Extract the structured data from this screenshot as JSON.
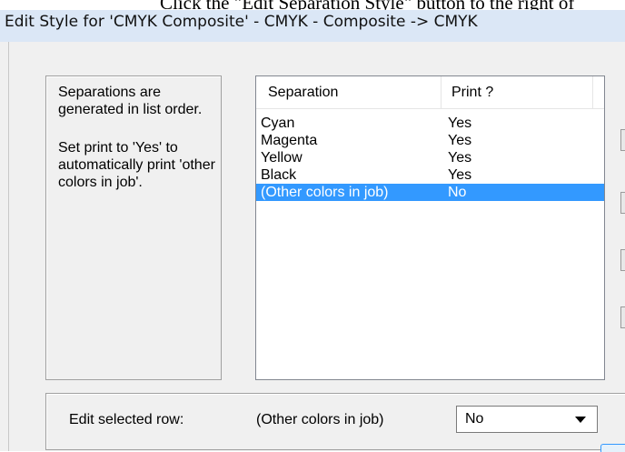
{
  "document": {
    "background_text": "Click the \"Edit Separation Style\" button to the right of"
  },
  "window": {
    "title": "Edit Style for 'CMYK Composite' - CMYK - Composite -> CMYK"
  },
  "info": {
    "paragraph1": "Separations are generated in list order.",
    "paragraph2": "Set print to 'Yes' to automatically print 'other colors in job'."
  },
  "list": {
    "columns": [
      "Separation",
      "Print ?"
    ],
    "rows": [
      {
        "separation": "Cyan",
        "print": "Yes",
        "selected": false
      },
      {
        "separation": "Magenta",
        "print": "Yes",
        "selected": false
      },
      {
        "separation": "Yellow",
        "print": "Yes",
        "selected": false
      },
      {
        "separation": "Black",
        "print": "Yes",
        "selected": false
      },
      {
        "separation": "(Other colors in job)",
        "print": "No",
        "selected": true
      }
    ]
  },
  "edit_row": {
    "label": "Edit selected row:",
    "row_name": "(Other colors in job)",
    "print_value": "No"
  },
  "colors": {
    "selection": "#3399ff",
    "title_bar": "#dbe7f6",
    "dialog_bg": "#f0f0f0"
  }
}
